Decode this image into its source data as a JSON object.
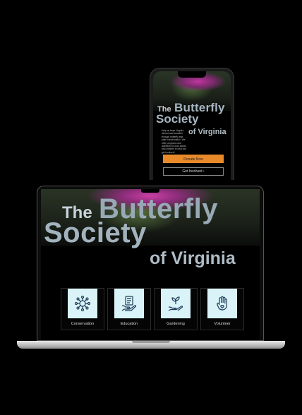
{
  "site": {
    "title_the": "The",
    "title_butterfly": "Butterfly",
    "title_society": "Society",
    "title_of_virginia": "of Virginia"
  },
  "mobile": {
    "body_text": "Help us keep Virginia vibrant and beautiful through butterfly and plant conservation. We offer programs and activities for both adults and children to help you get involved!",
    "donate_label": "Donate Now",
    "involved_label": "Get Involved  ›"
  },
  "categories": [
    {
      "label": "Conservation",
      "icon": "network-icon"
    },
    {
      "label": "Education",
      "icon": "book-hand-icon"
    },
    {
      "label": "Gardening",
      "icon": "seedling-hand-icon"
    },
    {
      "label": "Volunteer",
      "icon": "raised-hand-heart-icon"
    }
  ],
  "colors": {
    "accent": "#e8892a",
    "icon_bg": "#d9f3f8",
    "icon_stroke": "#1f3b57"
  }
}
